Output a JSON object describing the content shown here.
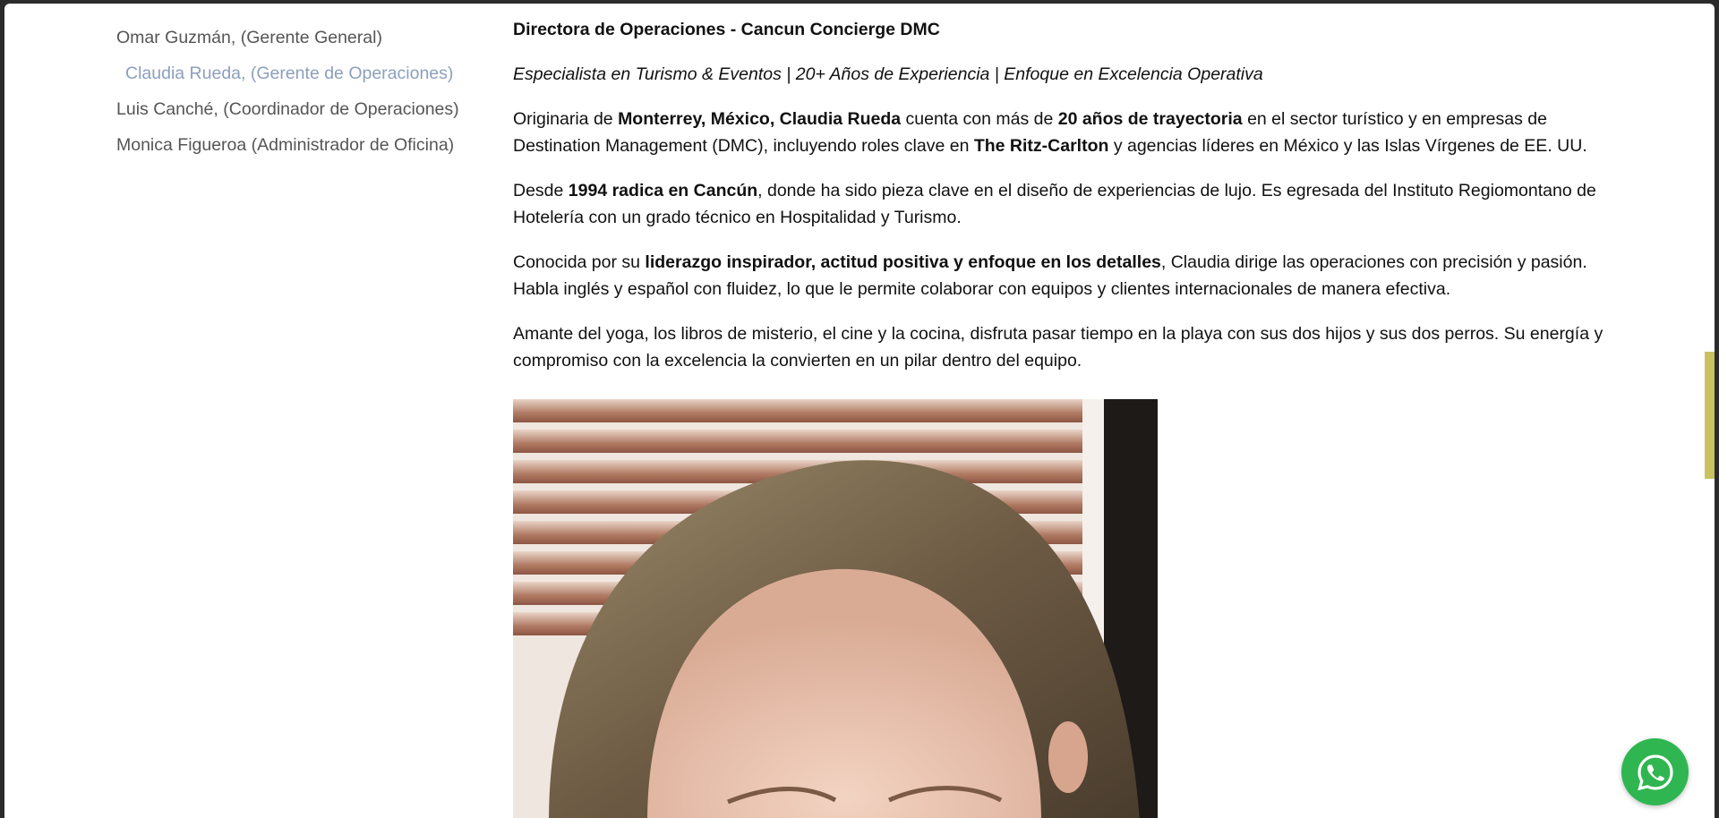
{
  "sidebar": {
    "items": [
      {
        "label": "Omar Guzmán, (Gerente General)"
      },
      {
        "label": "Claudia Rueda, (Gerente de Operaciones)"
      },
      {
        "label": "Luis Canché, (Coordinador de Operaciones)"
      },
      {
        "label": "Monica Figueroa (Administrador de Oficina)"
      }
    ]
  },
  "content": {
    "heading": "Directora de Operaciones - Cancun Concierge DMC",
    "subtitle": "Especialista en Turismo & Eventos | 20+ Años de Experiencia | Enfoque en Excelencia Operativa",
    "p1": {
      "a": "Originaria de ",
      "b1": "Monterrey, México, Claudia Rueda",
      "c": " cuenta con más de ",
      "b2": "20 años de trayectoria",
      "d": " en el sector turístico y en empresas de Destination Management (DMC), incluyendo roles clave en ",
      "b3": "The Ritz-Carlton",
      "e": " y agencias líderes en México y las Islas Vírgenes de EE. UU."
    },
    "p2": {
      "a": "Desde ",
      "b1": "1994 radica en Cancún",
      "c": ", donde ha sido pieza clave en el diseño de experiencias de lujo. Es egresada del Instituto Regiomontano de Hotelería con un grado técnico en Hospitalidad y Turismo."
    },
    "p3": {
      "a": "Conocida por su ",
      "b1": "liderazgo inspirador, actitud positiva y enfoque en los detalles",
      "c": ", Claudia dirige las operaciones con precisión y pasión. Habla inglés y español con fluidez, lo que le permite colaborar con equipos y clientes internacionales de manera efectiva."
    },
    "p4": "Amante del yoga, los libros de misterio, el cine y la cocina, disfruta pasar tiempo en la playa con sus dos hijos y sus dos perros. Su energía y compromiso con la excelencia la convierten en un pilar dentro del equipo."
  },
  "icons": {
    "whatsapp": "whatsapp-icon"
  },
  "colors": {
    "sidebar_text": "#555555",
    "sidebar_active": "#8c9fbe",
    "whatsapp": "#2fb650",
    "scroll_thumb": "#c9c060"
  }
}
